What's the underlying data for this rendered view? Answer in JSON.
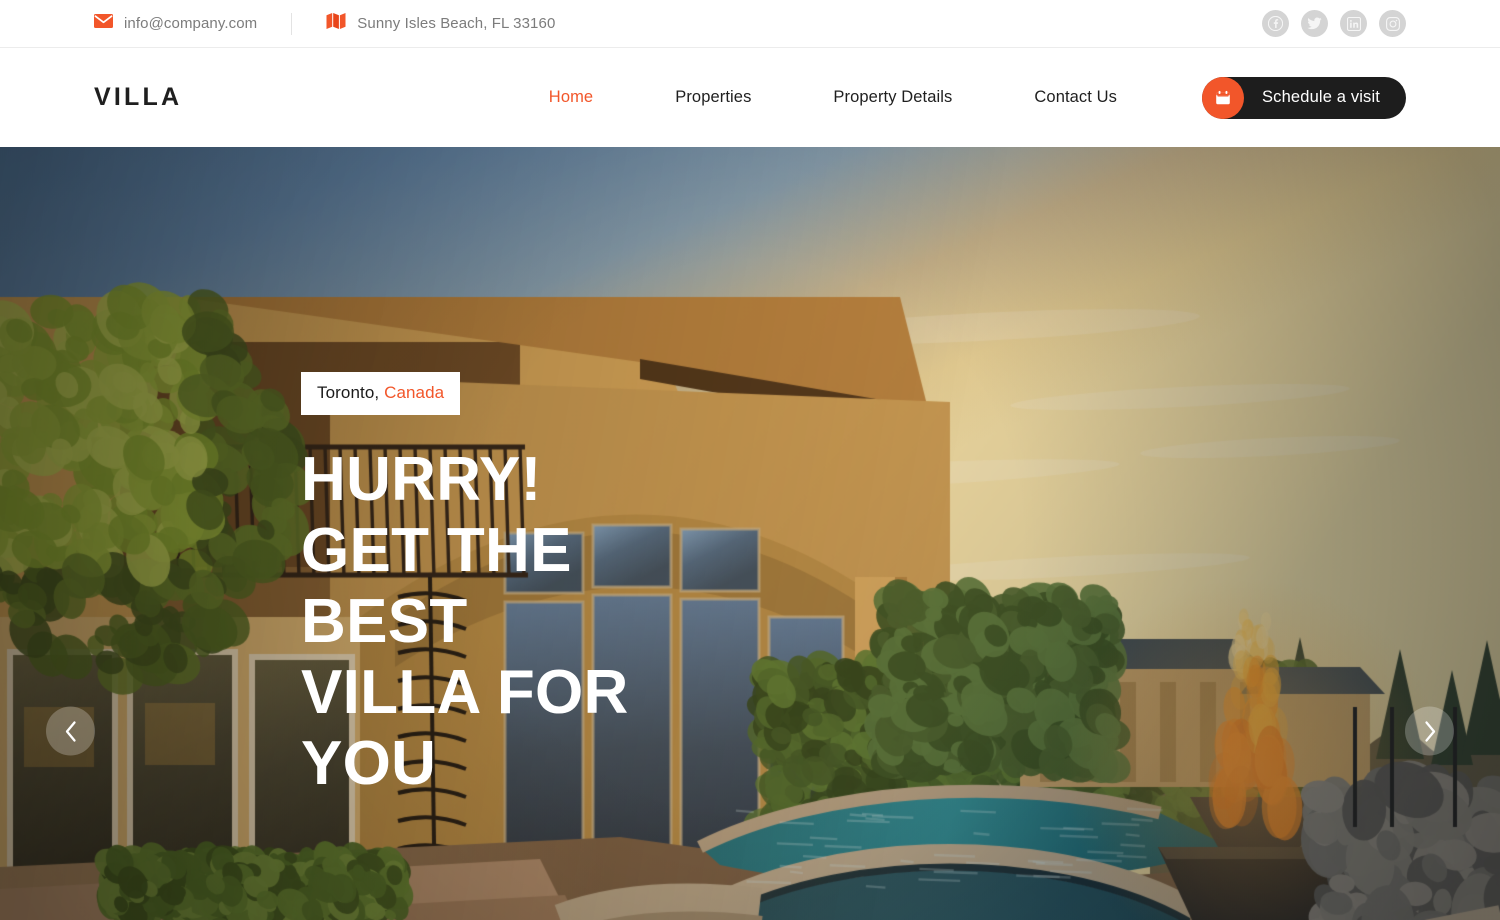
{
  "topbar": {
    "email": {
      "icon": "mail-icon",
      "text": "info@company.com"
    },
    "address": {
      "icon": "map-icon",
      "text": "Sunny Isles Beach, FL 33160"
    },
    "social": [
      {
        "name": "facebook-icon",
        "label": "Facebook"
      },
      {
        "name": "twitter-icon",
        "label": "Twitter"
      },
      {
        "name": "linkedin-icon",
        "label": "LinkedIn"
      },
      {
        "name": "instagram-icon",
        "label": "Instagram"
      }
    ]
  },
  "header": {
    "logo": "VILLA",
    "nav": [
      {
        "label": "Home",
        "active": true
      },
      {
        "label": "Properties",
        "active": false
      },
      {
        "label": "Property Details",
        "active": false
      },
      {
        "label": "Contact Us",
        "active": false
      }
    ],
    "cta": {
      "label": "Schedule a visit",
      "icon": "calendar-icon"
    }
  },
  "hero": {
    "badge": {
      "city": "Toronto,",
      "country": "Canada"
    },
    "title_lines": [
      "HURRY!",
      "GET THE BEST",
      "VILLA FOR",
      "YOU"
    ],
    "prev_arrow": "chevron-left-icon",
    "next_arrow": "chevron-right-icon",
    "image_description": "Mediterranean villa at sunset with swimming pool, spa and fire bowl"
  },
  "colors": {
    "accent": "#f2562a",
    "dark": "#1d1d1d",
    "muted_text": "#7c7c7c",
    "social_circle": "#d4d4d4"
  }
}
